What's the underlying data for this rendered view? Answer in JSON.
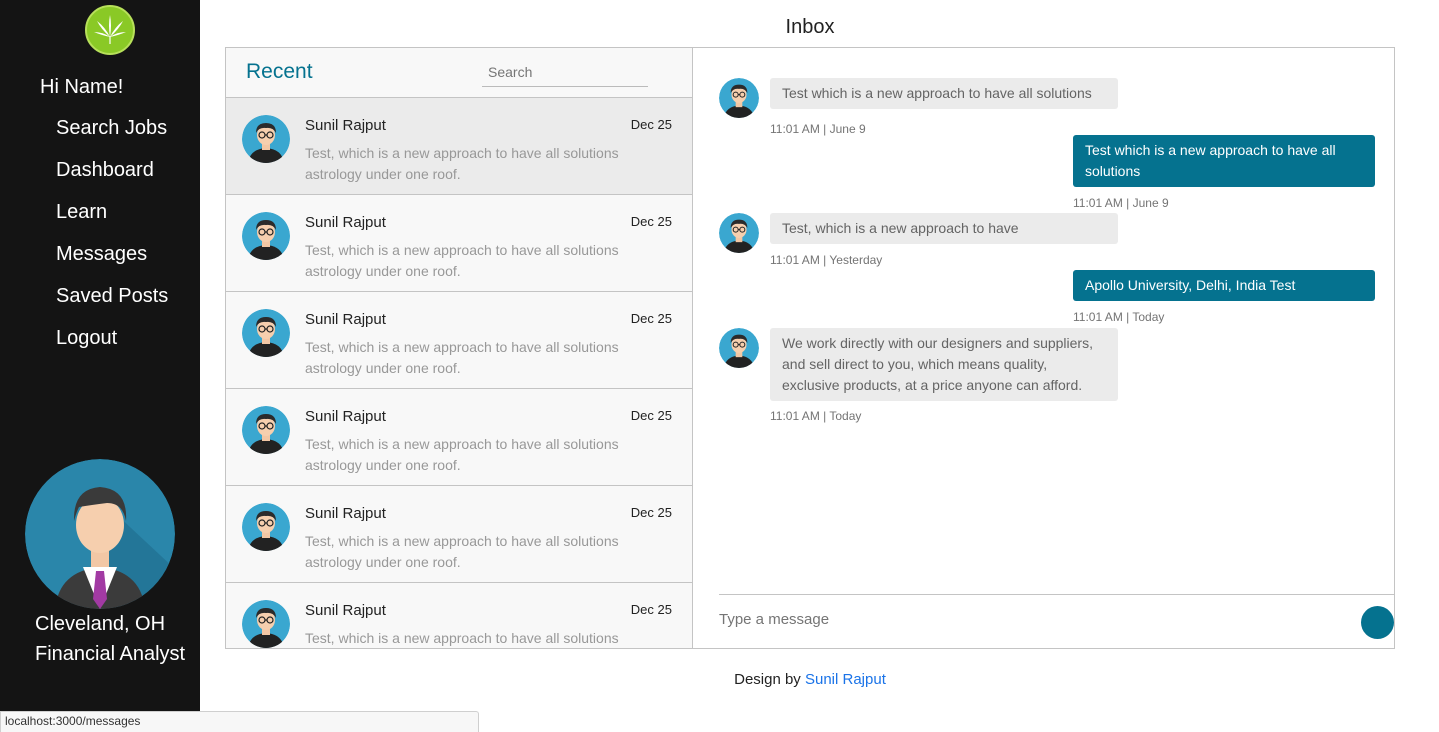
{
  "sidebar": {
    "greeting": "Hi Name!",
    "nav": [
      "Search Jobs",
      "Dashboard",
      "Learn",
      "Messages",
      "Saved Posts",
      "Logout"
    ],
    "location": "Cleveland, OH",
    "job_title": "Financial Analyst",
    "logo_icon": "cannabis-leaf-icon"
  },
  "inbox": {
    "title": "Inbox",
    "recent_label": "Recent",
    "search_placeholder": "Search"
  },
  "conversations": [
    {
      "name": "Sunil Rajput",
      "date": "Dec 25",
      "preview": "Test, which is a new approach to have all solutions astrology under one roof.",
      "active": true
    },
    {
      "name": "Sunil Rajput",
      "date": "Dec 25",
      "preview": "Test, which is a new approach to have all solutions astrology under one roof."
    },
    {
      "name": "Sunil Rajput",
      "date": "Dec 25",
      "preview": "Test, which is a new approach to have all solutions astrology under one roof."
    },
    {
      "name": "Sunil Rajput",
      "date": "Dec 25",
      "preview": "Test, which is a new approach to have all solutions astrology under one roof."
    },
    {
      "name": "Sunil Rajput",
      "date": "Dec 25",
      "preview": "Test, which is a new approach to have all solutions astrology under one roof."
    },
    {
      "name": "Sunil Rajput",
      "date": "Dec 25",
      "preview": "Test, which is a new approach to have all solutions astrology under one roof."
    }
  ],
  "messages": [
    {
      "direction": "in",
      "text": "Test which is a new approach to have all solutions",
      "time": "11:01 AM | June 9"
    },
    {
      "direction": "out",
      "text": "Test which is a new approach to have all solutions",
      "time": "11:01 AM | June 9"
    },
    {
      "direction": "in",
      "text": "Test, which is a new approach to have",
      "time": "11:01 AM | Yesterday"
    },
    {
      "direction": "out",
      "text": "Apollo University, Delhi, India Test",
      "time": "11:01 AM | Today"
    },
    {
      "direction": "in",
      "text": "We work directly with our designers and suppliers, and sell direct to you, which means quality, exclusive products, at a price anyone can afford.",
      "time": "11:01 AM | Today"
    }
  ],
  "composer": {
    "placeholder": "Type a message",
    "send_icon": "send-icon"
  },
  "footer": {
    "prefix": "Design by",
    "author": "Sunil Rajput"
  },
  "statusbar": {
    "url": "localhost:3000/messages"
  },
  "colors": {
    "sidebar_bg": "#141414",
    "accent": "#05728f",
    "logo_green": "#8ac926",
    "incoming_bubble": "#ebebeb",
    "link": "#1a73e8"
  }
}
